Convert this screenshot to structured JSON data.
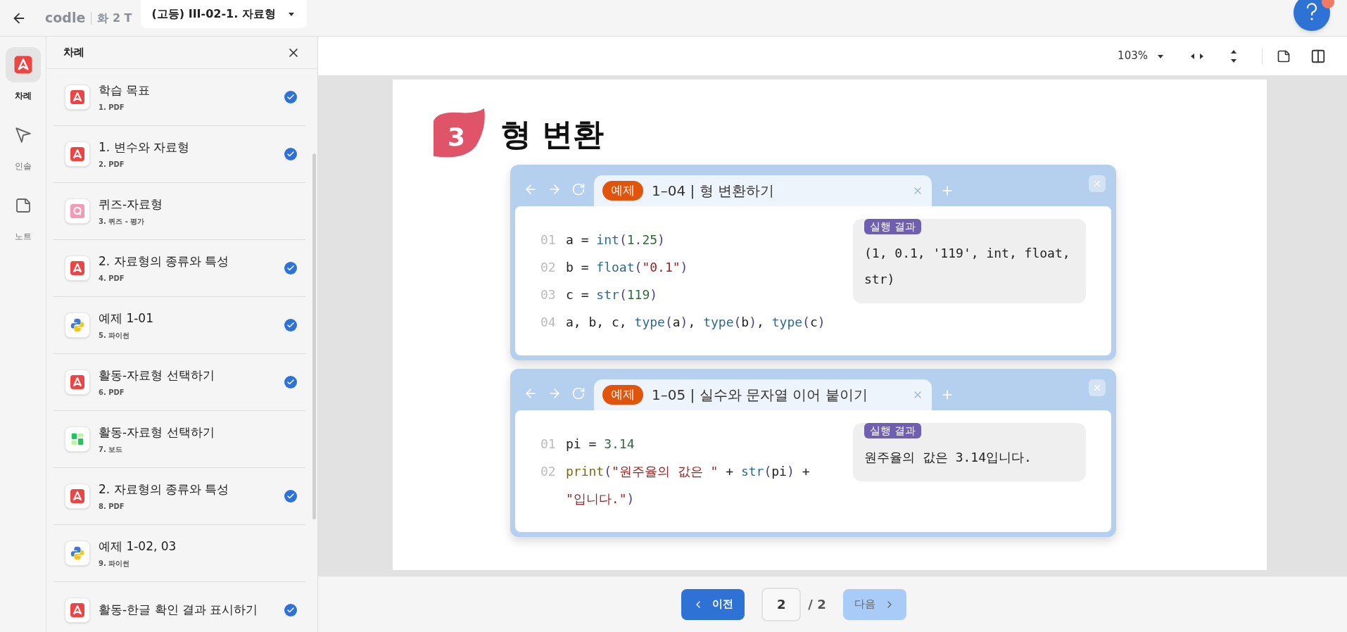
{
  "header": {
    "logo": "codle",
    "class_name": "화 2 T",
    "title": "(고등) III-02-1. 자료형"
  },
  "rail": [
    {
      "label": "차례",
      "kind": "toc",
      "selected": true
    },
    {
      "label": "인솔",
      "kind": "pointer",
      "selected": false
    },
    {
      "label": "노트",
      "kind": "note",
      "selected": false
    }
  ],
  "sidebar": {
    "title": "차례",
    "items": [
      {
        "title": "학습 목표",
        "subtitle": "1. PDF",
        "kind": "pdf",
        "checked": true
      },
      {
        "title": "1. 변수와 자료형",
        "subtitle": "2. PDF",
        "kind": "pdf",
        "checked": true
      },
      {
        "title": "퀴즈-자료형",
        "subtitle": "3. 퀴즈 - 평가",
        "kind": "quiz",
        "checked": false
      },
      {
        "title": "2. 자료형의 종류와 특성",
        "subtitle": "4. PDF",
        "kind": "pdf",
        "checked": true
      },
      {
        "title": "예제 1-01",
        "subtitle": "5. 파이썬",
        "kind": "python",
        "checked": true
      },
      {
        "title": "활동-자료형 선택하기",
        "subtitle": "6. PDF",
        "kind": "pdf",
        "checked": true
      },
      {
        "title": "활동-자료형 선택하기",
        "subtitle": "7. 보드",
        "kind": "board",
        "checked": false
      },
      {
        "title": "2. 자료형의 종류와 특성",
        "subtitle": "8. PDF",
        "kind": "pdf",
        "checked": true
      },
      {
        "title": "예제 1-02, 03",
        "subtitle": "9. 파이썬",
        "kind": "python",
        "checked": false
      },
      {
        "title": "활동-한글 확인 결과 표시하기",
        "kind": "pdf",
        "checked": true
      }
    ]
  },
  "toolbar": {
    "zoom": "103%"
  },
  "page": {
    "section_number": "3",
    "heading": "형 변환",
    "examples": [
      {
        "tag": "예제",
        "title": "1–04 | 형 변환하기",
        "result_label": "실행 결과",
        "result": "(1, 0.1, '119', int, float, str)",
        "lines": [
          {
            "number": "01",
            "tokens": [
              {
                "text": "a = ",
                "kind": "plain"
              },
              {
                "text": "int",
                "kind": "func"
              },
              {
                "text": "(",
                "kind": "paren"
              },
              {
                "text": "1.25",
                "kind": "number"
              },
              {
                "text": ")",
                "kind": "paren"
              }
            ]
          },
          {
            "number": "02",
            "tokens": [
              {
                "text": "b = ",
                "kind": "plain"
              },
              {
                "text": "float",
                "kind": "func"
              },
              {
                "text": "(",
                "kind": "paren"
              },
              {
                "text": "\"0.1\"",
                "kind": "string"
              },
              {
                "text": ")",
                "kind": "paren"
              }
            ]
          },
          {
            "number": "03",
            "tokens": [
              {
                "text": "c = ",
                "kind": "plain"
              },
              {
                "text": "str",
                "kind": "func"
              },
              {
                "text": "(",
                "kind": "paren"
              },
              {
                "text": "119",
                "kind": "number"
              },
              {
                "text": ")",
                "kind": "paren"
              }
            ]
          },
          {
            "number": "04",
            "tokens": [
              {
                "text": "a, b, c, ",
                "kind": "plain"
              },
              {
                "text": "type",
                "kind": "func"
              },
              {
                "text": "(",
                "kind": "paren"
              },
              {
                "text": "a",
                "kind": "plain"
              },
              {
                "text": ")",
                "kind": "paren"
              },
              {
                "text": ", ",
                "kind": "plain"
              },
              {
                "text": "type",
                "kind": "func"
              },
              {
                "text": "(",
                "kind": "paren"
              },
              {
                "text": "b",
                "kind": "plain"
              },
              {
                "text": ")",
                "kind": "paren"
              },
              {
                "text": ", ",
                "kind": "plain"
              },
              {
                "text": "type",
                "kind": "func"
              },
              {
                "text": "(",
                "kind": "paren"
              },
              {
                "text": "c",
                "kind": "plain"
              },
              {
                "text": ")",
                "kind": "paren"
              }
            ]
          }
        ]
      },
      {
        "tag": "예제",
        "title": "1–05 | 실수와 문자열 이어 붙이기",
        "result_label": "실행 결과",
        "result": "원주율의 값은 3.14입니다.",
        "lines": [
          {
            "number": "01",
            "tokens": [
              {
                "text": "pi = ",
                "kind": "plain"
              },
              {
                "text": "3.14",
                "kind": "number"
              }
            ]
          },
          {
            "number": "02",
            "tokens": [
              {
                "text": "print",
                "kind": "print"
              },
              {
                "text": "(",
                "kind": "paren"
              },
              {
                "text": "\"원주율의 값은 \"",
                "kind": "string"
              },
              {
                "text": " + ",
                "kind": "plain"
              },
              {
                "text": "str",
                "kind": "func"
              },
              {
                "text": "(",
                "kind": "paren"
              },
              {
                "text": "pi",
                "kind": "plain"
              },
              {
                "text": ")",
                "kind": "paren"
              },
              {
                "text": " +",
                "kind": "plain"
              }
            ]
          },
          {
            "tokens": [
              {
                "text": "\"입니다.\"",
                "kind": "string"
              },
              {
                "text": ")",
                "kind": "paren"
              }
            ]
          }
        ]
      }
    ]
  },
  "pagination": {
    "prev": "이전",
    "page": "2",
    "total": "/ 2",
    "next": "다음",
    "next_disabled": true
  }
}
